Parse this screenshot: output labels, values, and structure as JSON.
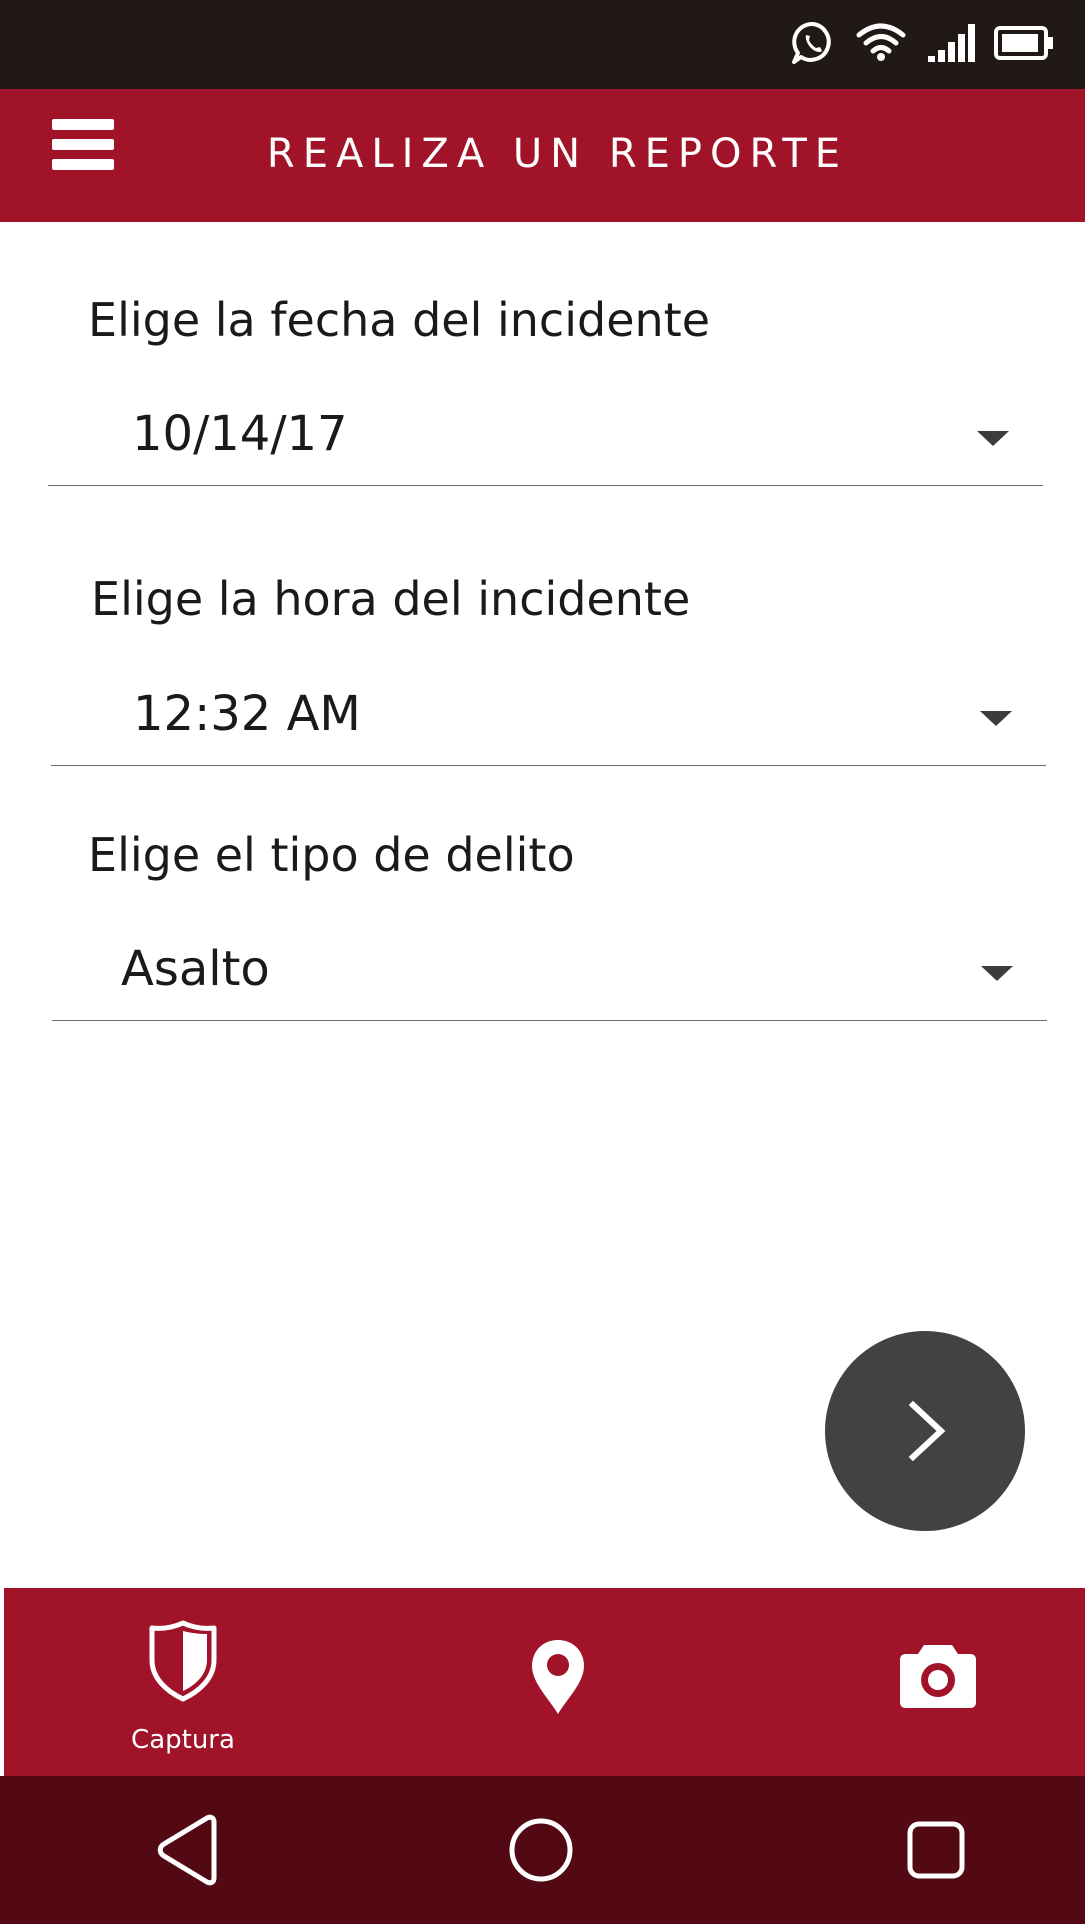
{
  "colors": {
    "status_bar": "#211915",
    "primary": "#a01328",
    "system_nav": "#520914",
    "fab": "#434141",
    "text": "#1a1a1a",
    "divider": "#6b6b6b"
  },
  "status_bar": {
    "icons": [
      "whatsapp-icon",
      "wifi-icon",
      "cellular-signal-icon",
      "battery-icon"
    ]
  },
  "app_bar": {
    "menu_icon": "hamburger-menu-icon",
    "title": "REALIZA UN REPORTE"
  },
  "form": {
    "date": {
      "label": "Elige la fecha del incidente",
      "value": "10/14/17"
    },
    "time": {
      "label": "Elige la hora del incidente",
      "value": "12:32 AM"
    },
    "crime_type": {
      "label": "Elige el tipo de delito",
      "value": "Asalto"
    }
  },
  "fab": {
    "icon": "chevron-right-icon"
  },
  "bottom_nav": {
    "items": [
      {
        "icon": "shield-icon",
        "label": "Captura"
      },
      {
        "icon": "location-pin-icon",
        "label": ""
      },
      {
        "icon": "camera-icon",
        "label": ""
      }
    ]
  },
  "system_nav": {
    "buttons": [
      "back-icon",
      "home-icon",
      "recents-icon"
    ]
  }
}
